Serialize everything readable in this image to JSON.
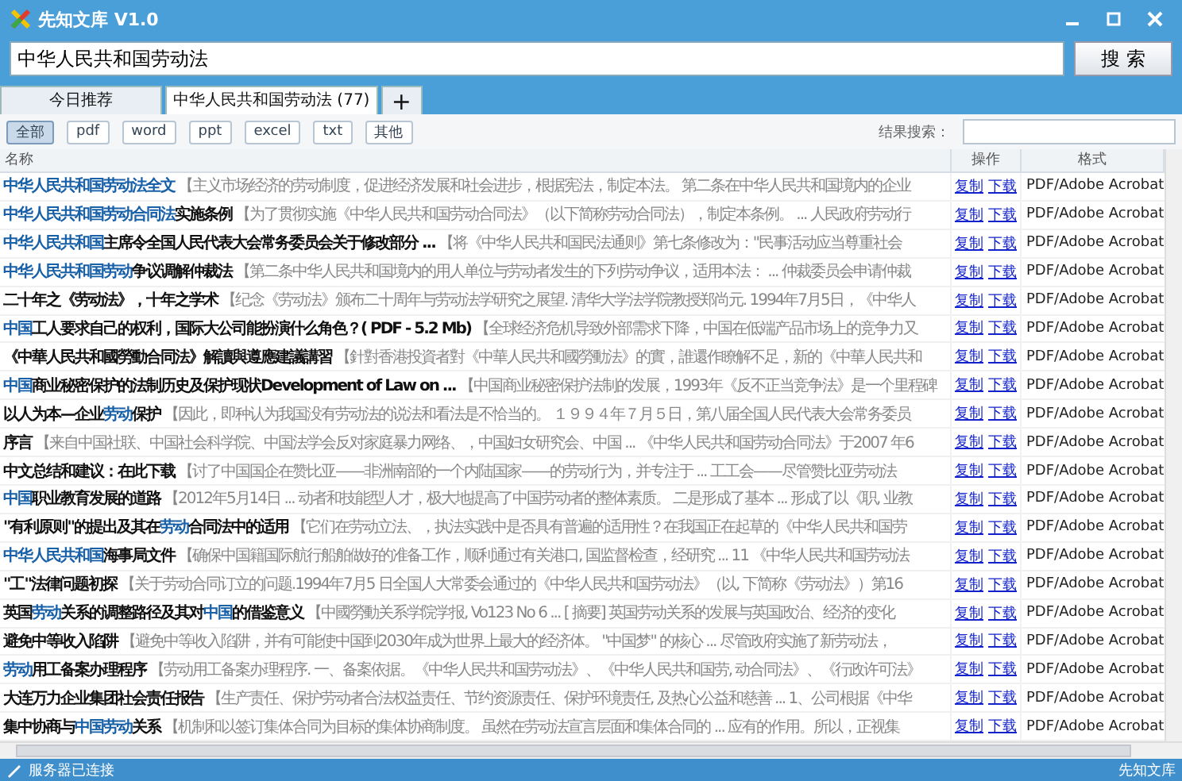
{
  "window": {
    "title": "先知文库 V1.0"
  },
  "search": {
    "value": "中华人民共和国劳动法",
    "button": "搜 索"
  },
  "tabs": [
    {
      "label": "今日推荐",
      "selected": false
    },
    {
      "label": "中华人民共和国劳动法 (77)",
      "selected": true
    },
    {
      "label": "+",
      "selected": false
    }
  ],
  "filters": [
    {
      "label": "全部",
      "selected": true
    },
    {
      "label": "pdf",
      "selected": false
    },
    {
      "label": "word",
      "selected": false
    },
    {
      "label": "ppt",
      "selected": false
    },
    {
      "label": "excel",
      "selected": false
    },
    {
      "label": "txt",
      "selected": false
    },
    {
      "label": "其他",
      "selected": false
    }
  ],
  "result_search": {
    "label": "结果搜索："
  },
  "table": {
    "columns": [
      "名称",
      "操作",
      "格式"
    ],
    "rows": [
      {
        "title": [
          {
            "text": "中华人民共和国劳动法全文",
            "match": true
          }
        ],
        "snippet": "【主义市场经济的劳动制度，促进经济发展和社会进步，根据宪法，制定本法。 第二条在中华人民共和国境内的企业",
        "actions": [
          "复制",
          "下载"
        ],
        "format": "PDF/Adobe Acrobat"
      },
      {
        "title": [
          {
            "text": "中华人民共和国劳动合同法",
            "match": true
          },
          {
            "text": "实施条例",
            "match": false
          }
        ],
        "snippet": "【为了贯彻实施《中华人民共和国劳动合同法》（以下简称劳动合同法），制定本条例。 ... 人民政府劳动行",
        "actions": [
          "复制",
          "下载"
        ],
        "format": "PDF/Adobe Acrobat"
      },
      {
        "title": [
          {
            "text": "中华人民共和国",
            "match": true
          },
          {
            "text": "主席令全国人民代表大会常务委员会关于修改部分 ...",
            "match": false
          }
        ],
        "snippet": "【将《中华人民共和国民法通则》第七条修改为：\"民事活动应当尊重社会",
        "actions": [
          "复制",
          "下载"
        ],
        "format": "PDF/Adobe Acrobat"
      },
      {
        "title": [
          {
            "text": "中华人民共和国劳动",
            "match": true
          },
          {
            "text": "争议调解仲裁法",
            "match": false
          }
        ],
        "snippet": "【第二条中华人民共和国境内的用人单位与劳动者发生的下列劳动争议，适用本法： ... 仲裁委员会申请仲裁",
        "actions": [
          "复制",
          "下载"
        ],
        "format": "PDF/Adobe Acrobat"
      },
      {
        "title": [
          {
            "text": "二十年之《劳动法》，十年之学术",
            "match": false
          }
        ],
        "snippet": "【纪念《劳动法》颁布二十周年与劳动法学研究之展望. 清华大学法学院教授郑尚元. 1994年7月5日，《中华人",
        "actions": [
          "复制",
          "下载"
        ],
        "format": "PDF/Adobe Acrobat"
      },
      {
        "title": [
          {
            "text": "中国",
            "match": true
          },
          {
            "text": "工人要求自己的权利，国际大公司能扮演什么角色？( PDF - 5.2 Mb)",
            "match": false
          }
        ],
        "snippet": "【全球经济危机导致外部需求下降，中国在低端产品市场上的竞争力又",
        "actions": [
          "复制",
          "下载"
        ],
        "format": "PDF/Adobe Acrobat"
      },
      {
        "title": [
          {
            "text": "《中華人民共和國勞動合同法》解讀與遵應建議講習",
            "match": false
          }
        ],
        "snippet": "【針對香港投資者對《中華人民共和國勞動法》的實，誰還作瞭解不足，新的《中華人民共和",
        "actions": [
          "复制",
          "下载"
        ],
        "format": "PDF/Adobe Acrobat"
      },
      {
        "title": [
          {
            "text": "中国",
            "match": true
          },
          {
            "text": "商业秘密保护的法制历史及保护现状Development of Law on ...",
            "match": false
          }
        ],
        "snippet": "【中国商业秘密保护法制的发展，1993年《反不正当竞争法》是一个里程碑",
        "actions": [
          "复制",
          "下载"
        ],
        "format": "PDF/Adobe Acrobat"
      },
      {
        "title": [
          {
            "text": "以人为本—企业",
            "match": false
          },
          {
            "text": "劳动",
            "match": true
          },
          {
            "text": "保护",
            "match": false
          }
        ],
        "snippet": "【因此，即种认为我国没有劳动法的说法和看法是不恰当的。 １９９４年７月５日，第八届全国人民代表大会常务委员",
        "actions": [
          "复制",
          "下载"
        ],
        "format": "PDF/Adobe Acrobat"
      },
      {
        "title": [
          {
            "text": "序言",
            "match": false
          }
        ],
        "snippet": "【来自中国社联、中国社会科学院、中国法学会反对家庭暴力网络、，中国妇女研究会、中国 ... 《中华人民共和国劳动合同法》于2007 年6",
        "actions": [
          "复制",
          "下载"
        ],
        "format": "PDF/Adobe Acrobat"
      },
      {
        "title": [
          {
            "text": "中文总结和建议：在此下载",
            "match": false
          }
        ],
        "snippet": "【讨了中国国企在赞比亚——非洲南部的一个内陆国家——的劳动行为，并专注于 ... 工工会——尽管赞比亚劳动法",
        "actions": [
          "复制",
          "下载"
        ],
        "format": "PDF/Adobe Acrobat"
      },
      {
        "title": [
          {
            "text": "中国",
            "match": true
          },
          {
            "text": "职业教育发展的道路",
            "match": false
          }
        ],
        "snippet": "【2012年5月14日 ... 动者和技能型人才，极大地提高了中国劳动者的整体素质。 二是形成了基本 ... 形成了以《职, 业教",
        "actions": [
          "复制",
          "下载"
        ],
        "format": "PDF/Adobe Acrobat"
      },
      {
        "title": [
          {
            "text": "\"有利原则\"的提出及其在",
            "match": false
          },
          {
            "text": "劳动",
            "match": true
          },
          {
            "text": "合同法中的适用",
            "match": false
          }
        ],
        "snippet": "【它们在劳动立法、，执法实践中是否具有普遍的适用性？在我国正在起草的《中华人民共和国劳",
        "actions": [
          "复制",
          "下载"
        ],
        "format": "PDF/Adobe Acrobat"
      },
      {
        "title": [
          {
            "text": "中华人民共和国",
            "match": true
          },
          {
            "text": "海事局文件",
            "match": false
          }
        ],
        "snippet": "【确保中国籍国际航行船舶做好的准备工作，顺利通过有关港口, 国监督检查，经研究 ... 11 《中华人民共和国劳动法",
        "actions": [
          "复制",
          "下载"
        ],
        "format": "PDF/Adobe Acrobat"
      },
      {
        "title": [
          {
            "text": "\"工\"法律问题初探",
            "match": false
          }
        ],
        "snippet": "【关于劳动合同订立的问题.1994年7月5 日全国人大常委会通过的《中华人民共和国劳动法》（以, 下简称《劳动法》）第16",
        "actions": [
          "复制",
          "下载"
        ],
        "format": "PDF/Adobe Acrobat"
      },
      {
        "title": [
          {
            "text": "英国",
            "match": false
          },
          {
            "text": "劳动",
            "match": true
          },
          {
            "text": "关系的调整路径及其对",
            "match": false
          },
          {
            "text": "中国",
            "match": true
          },
          {
            "text": "的借鉴意义",
            "match": false
          }
        ],
        "snippet": "【中國勞動关系学院学报, Vo123 No 6 ... [ 摘要] 英国劳动关系的发展与英国政治、经济的变化",
        "actions": [
          "复制",
          "下载"
        ],
        "format": "PDF/Adobe Acrobat"
      },
      {
        "title": [
          {
            "text": "避免中等收入陷阱",
            "match": false
          }
        ],
        "snippet": "【避免中等收入陷阱，并有可能使中国到2030年成为世界上最大的经济体。 \"中国梦\" 的核心 ... 尽管政府实施了新劳动法，",
        "actions": [
          "复制",
          "下载"
        ],
        "format": "PDF/Adobe Acrobat"
      },
      {
        "title": [
          {
            "text": "劳动",
            "match": true
          },
          {
            "text": "用工备案办理程序",
            "match": false
          }
        ],
        "snippet": "【劳动用工备案办理程序. 一、备案依据。《中华人民共和国劳动法》、《中华人民共和国劳, 动合同法》、《行政许可法》",
        "actions": [
          "复制",
          "下载"
        ],
        "format": "PDF/Adobe Acrobat"
      },
      {
        "title": [
          {
            "text": "大连万力企业集团社会责任报告",
            "match": false
          }
        ],
        "snippet": "【生产责任、保护劳动者合法权益责任、节约资源责任、保护环境责任, 及热心公益和慈善 ... 1、公司根据《中华",
        "actions": [
          "复制",
          "下载"
        ],
        "format": "PDF/Adobe Acrobat"
      },
      {
        "title": [
          {
            "text": "集中协商与",
            "match": false
          },
          {
            "text": "中国劳动",
            "match": true
          },
          {
            "text": "关系",
            "match": false
          }
        ],
        "snippet": "【机制和以签订集体合同为目标的集体协商制度。 虽然在劳动法宣言层面和集体合同的 ... 应有的作用。所以，正视集",
        "actions": [
          "复制",
          "下载"
        ],
        "format": "PDF/Adobe Acrobat"
      }
    ]
  },
  "status_bar": {
    "text": "服务器已连接",
    "brand": "先知文库"
  }
}
